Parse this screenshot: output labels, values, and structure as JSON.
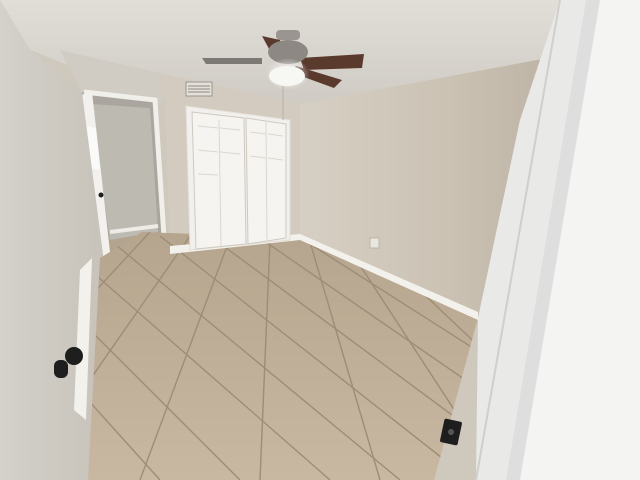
{
  "scene": {
    "type": "photo",
    "colors": {
      "ceiling": "#d9d6d0",
      "back_wall": "#cec6b9",
      "left_wall": "#d2cfc8",
      "hall_wall": "#bdbab2",
      "floor": "#bfae97",
      "grout": "#9d8c76",
      "baseboard": "#f3f1ec",
      "door_white": "#f4f4f2",
      "fan_blade": "#5b3a2e",
      "fan_body": "#9a9590",
      "hardware": "#1e1e1e"
    }
  }
}
